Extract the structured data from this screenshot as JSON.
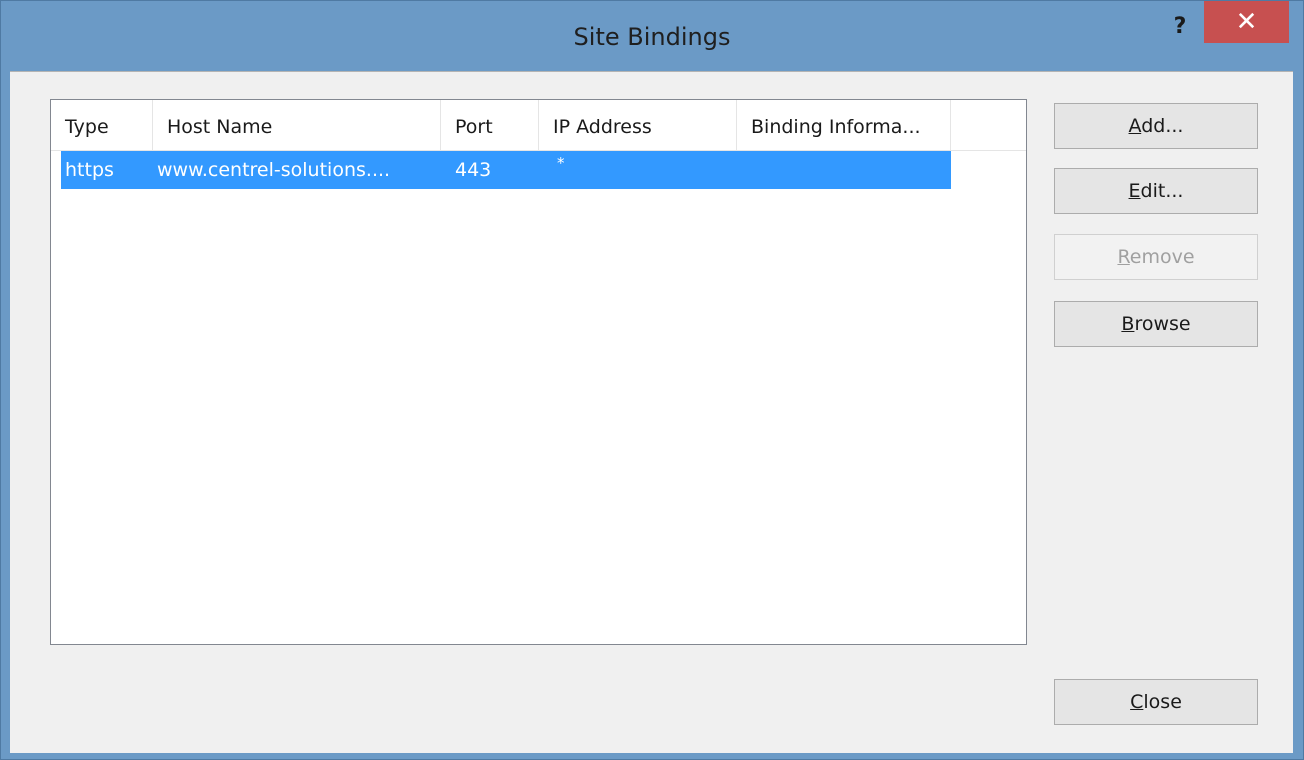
{
  "window": {
    "title": "Site Bindings",
    "help_glyph": "?",
    "close_glyph": "✕"
  },
  "listview": {
    "columns": [
      "Type",
      "Host Name",
      "Port",
      "IP Address",
      "Binding Informa..."
    ],
    "rows": [
      {
        "type": "https",
        "host_name": "www.centrel-solutions....",
        "port": "443",
        "ip_address": "*",
        "binding_information": "",
        "selected": true
      }
    ]
  },
  "buttons": {
    "add": {
      "accel": "A",
      "rest": "dd...",
      "enabled": true
    },
    "edit": {
      "accel": "E",
      "rest": "dit...",
      "enabled": true
    },
    "remove": {
      "accel": "R",
      "rest": "emove",
      "enabled": false
    },
    "browse": {
      "accel": "B",
      "rest": "rowse",
      "enabled": true
    },
    "close": {
      "accel": "C",
      "rest": "lose",
      "enabled": true
    }
  },
  "colors": {
    "title_bar": "#6b9ac6",
    "close_button": "#c75050",
    "selection": "#3399ff",
    "client_background": "#f0f0f0"
  }
}
